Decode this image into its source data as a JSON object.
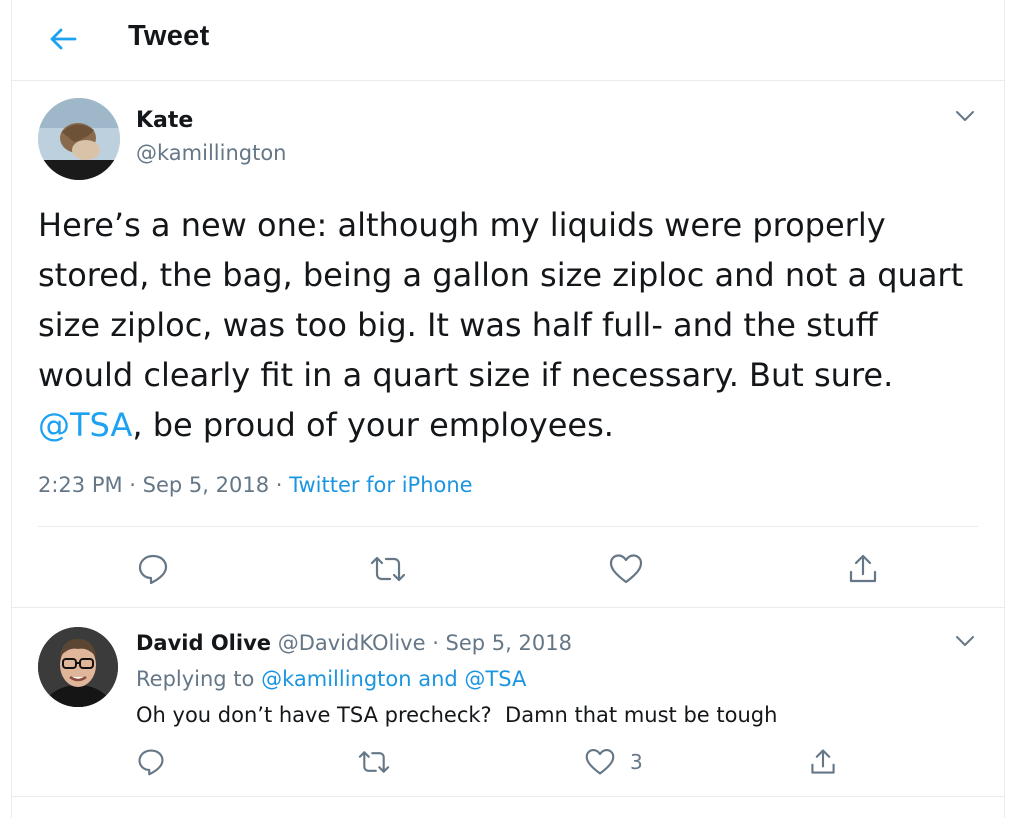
{
  "header": {
    "title": "Tweet",
    "back_icon": "arrow-left-icon",
    "accent_color": "#1da1f2"
  },
  "main_tweet": {
    "author_name": "Kate",
    "author_handle": "@kamillington",
    "text_part1": "Here’s a new one: although my liquids were properly stored, the bag, being a gallon size ziploc and not a quart size ziploc, was too big. It was half full- and the stuff would clearly fit in a quart size if necessary. But sure. ",
    "mention": "@TSA",
    "text_part2": ", be proud of your employees.",
    "time": "2:23 PM",
    "separator": " · ",
    "date": "Sep 5, 2018",
    "source": "Twitter for iPhone",
    "actions": [
      "reply-icon",
      "retweet-icon",
      "like-icon",
      "share-icon"
    ]
  },
  "reply": {
    "author_name": "David Olive",
    "author_handle": "@DavidKOlive",
    "separator": " · ",
    "date": "Sep 5, 2018",
    "replying_prefix": "Replying to ",
    "replying_to": "@kamillington and @TSA",
    "text": "Oh you don’t have TSA precheck?  Damn that must be tough",
    "like_count": "3",
    "actions": [
      "reply-icon",
      "retweet-icon",
      "like-icon",
      "share-icon"
    ]
  },
  "colors": {
    "text": "#14171a",
    "secondary": "#657786",
    "link": "#1b95e0",
    "border": "#e6ecf0"
  }
}
